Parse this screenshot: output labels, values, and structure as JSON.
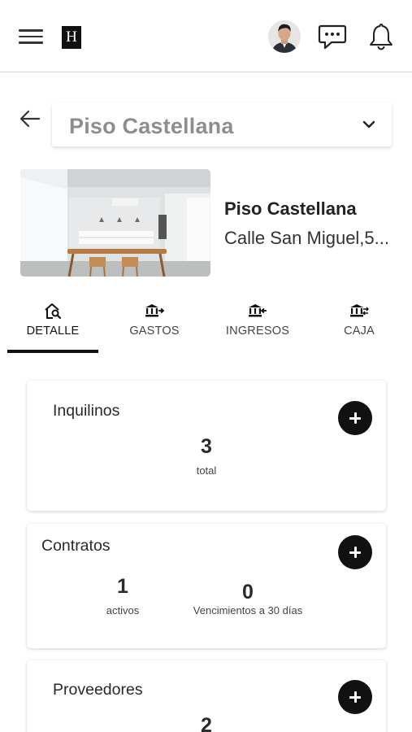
{
  "header": {
    "logo_letter": "H",
    "menu_icon": "hamburger-menu-icon",
    "chat_icon": "chat-bubble-icon",
    "bell_icon": "bell-icon"
  },
  "property_selector": {
    "value": "Piso Castellana"
  },
  "property": {
    "name": "Piso Castellana",
    "address": "Calle San Miguel,5..."
  },
  "tabs": [
    {
      "label": "DETALLE",
      "icon": "house-search-icon",
      "active": true
    },
    {
      "label": "GASTOS",
      "icon": "bank-arrow-out-icon",
      "active": false
    },
    {
      "label": "INGRESOS",
      "icon": "bank-arrow-in-icon",
      "active": false
    },
    {
      "label": "CAJA",
      "icon": "bank-exchange-icon",
      "active": false
    }
  ],
  "cards": {
    "inquilinos": {
      "title": "Inquilinos",
      "count": "3",
      "count_label": "total"
    },
    "contratos": {
      "title": "Contratos",
      "activos": "1",
      "activos_label": "activos",
      "vencimientos": "0",
      "vencimientos_label": "Vencimientos a 30 días"
    },
    "proveedores": {
      "title": "Proveedores",
      "count": "2"
    }
  },
  "colors": {
    "accent": "#111111",
    "selector_text": "#8e8e8e",
    "divider": "#d9d9d9"
  }
}
